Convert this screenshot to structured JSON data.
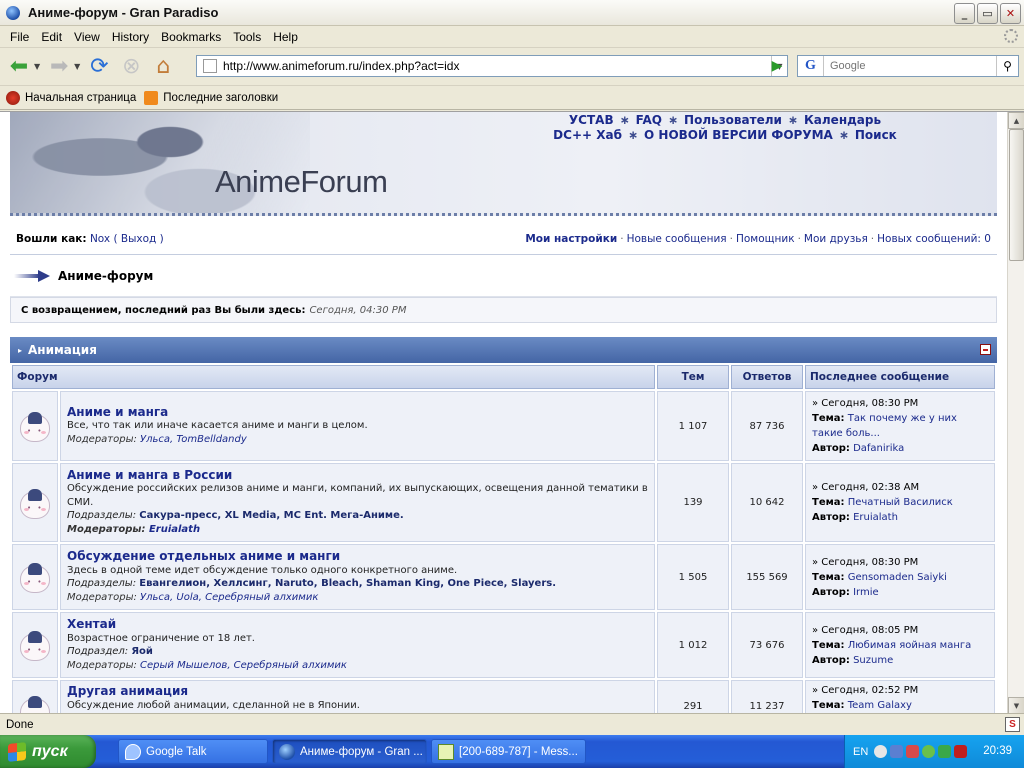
{
  "window": {
    "title": "Аниме-форум - Gran Paradiso",
    "min": "_",
    "max": "▭",
    "close": "✕"
  },
  "menu": [
    "File",
    "Edit",
    "View",
    "History",
    "Bookmarks",
    "Tools",
    "Help"
  ],
  "nav": {
    "url": "http://www.animeforum.ru/index.php?act=idx",
    "search_placeholder": "Google"
  },
  "bookmarks": [
    "Начальная страница",
    "Последние заголовки"
  ],
  "site": {
    "logo": "AnimeForum",
    "top_links_row1": [
      "УСТАВ",
      "FAQ",
      "Пользователи",
      "Календарь"
    ],
    "top_links_row2": [
      "DC++ Хаб",
      "О НОВОЙ ВЕРСИИ ФОРУМА",
      "Поиск"
    ],
    "star": "∗"
  },
  "userbar": {
    "logged_as_label": "Вошли как:",
    "username": "Nox",
    "logout": "( Выход )",
    "links": [
      "Мои настройки",
      "Новые сообщения",
      "Помощник",
      "Мои друзья",
      "Новых сообщений: 0"
    ]
  },
  "breadcrumb": "Аниме-форум",
  "welcome": {
    "text": "С возвращением, последний раз Вы были здесь:",
    "time": "Сегодня, 04:30 PM"
  },
  "category": "Анимация",
  "table": {
    "headers": [
      "Форум",
      "Тем",
      "Ответов",
      "Последнее сообщение"
    ],
    "rows": [
      {
        "title": "Аниме и манга",
        "desc": "Все, что так или иначе касается аниме и манги в целом.",
        "sub_label": "",
        "subs": "",
        "mods_label": "Модераторы:",
        "mods": "Ульса, TomBelldandy",
        "topics": "1 107",
        "replies": "87 736",
        "last_date": "» Сегодня, 08:30 PM",
        "last_topic": "Так почему же у них такие боль...",
        "last_author": "Dafanirika"
      },
      {
        "title": "Аниме и манга в России",
        "desc": "Обсуждение российских релизов аниме и манги, компаний, их выпускающих, освещения данной тематики в СМИ.",
        "sub_label": "Подразделы:",
        "subs": "Сакура-пресс, XL Media, MC Ent. Мега-Аниме.",
        "mods_label": "Модераторы:",
        "mods": "Eruialath",
        "topics": "139",
        "replies": "10 642",
        "last_date": "» Сегодня, 02:38 AM",
        "last_topic": "Печатный Василиск",
        "last_author": "Eruialath"
      },
      {
        "title": "Обсуждение отдельных аниме и манги",
        "desc": "Здесь в одной теме идет обсуждение только одного конкретного аниме.",
        "sub_label": "Подразделы:",
        "subs": "Евангелион, Хеллсинг, Naruto, Bleach, Shaman King, One Piece, Slayers.",
        "mods_label": "Модераторы:",
        "mods": "Ульса, Uola, Серебряный алхимик",
        "topics": "1 505",
        "replies": "155 569",
        "last_date": "» Сегодня, 08:30 PM",
        "last_topic": "Gensomaden Saiyki",
        "last_author": "Irmie"
      },
      {
        "title": "Хентай",
        "desc": "Возрастное ограничение от 18 лет.",
        "sub_label": "Подраздел:",
        "subs": "Яой",
        "mods_label": "Модераторы:",
        "mods": "Серый Мышелов, Серебряный алхимик",
        "topics": "1 012",
        "replies": "73 676",
        "last_date": "» Сегодня, 08:05 PM",
        "last_topic": "Любимая яойная манга",
        "last_author": "Suzume"
      },
      {
        "title": "Другая анимация",
        "desc": "Обсуждение любой анимации, сделанной не в Японии.",
        "sub_label": "",
        "subs": "",
        "mods_label": "",
        "mods": "",
        "topics": "291",
        "replies": "11 237",
        "last_date": "» Сегодня, 02:52 PM",
        "last_topic": "Team Galaxy",
        "last_author": ""
      }
    ],
    "topic_label": "Тема:",
    "author_label": "Автор:"
  },
  "status": "Done",
  "taskbar": {
    "start": "пуск",
    "tasks": [
      "Google Talk",
      "Аниме-форум - Gran ...",
      "[200-689-787] - Mess..."
    ],
    "lang": "EN",
    "clock": "20:39"
  }
}
